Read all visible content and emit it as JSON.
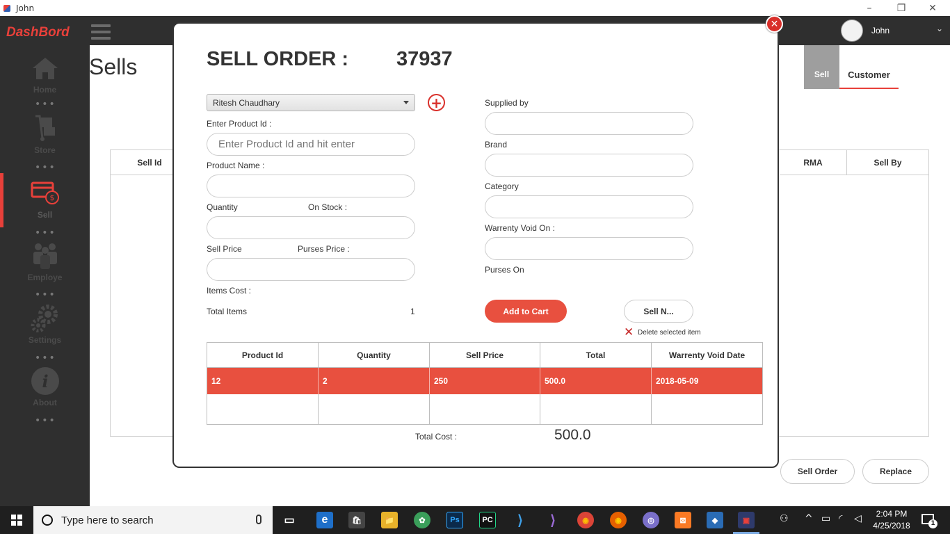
{
  "window": {
    "title": "John",
    "minimize": "–",
    "restore": "❐",
    "close": "✕"
  },
  "app": {
    "brand": "DashBord"
  },
  "sidebar": {
    "items": [
      {
        "label": "Home"
      },
      {
        "label": "Store"
      },
      {
        "label": "Sell"
      },
      {
        "label": "Employe"
      },
      {
        "label": "Settings"
      },
      {
        "label": "About"
      }
    ],
    "dots": "•••",
    "active": "Sell",
    "accent": "#e8403a"
  },
  "user": {
    "name": "John",
    "chevron": "⌄"
  },
  "page": {
    "title": "Sells",
    "tabs": [
      {
        "label": "Sell"
      },
      {
        "label": "Customer"
      }
    ],
    "table_headers": {
      "sell_id": "Sell Id",
      "rma": "RMA",
      "sell_by": "Sell By"
    },
    "buttons": {
      "sell_order": "Sell Order",
      "replace": "Replace"
    }
  },
  "modal": {
    "close_glyph": "✕",
    "title": "SELL ORDER :",
    "order_number": "37937",
    "customer_select": "Ritesh Chaudhary",
    "add_glyph": "+",
    "labels": {
      "enter_product_id": "Enter Product Id :",
      "product_name": "Product Name :",
      "quantity": "Quantity",
      "on_stock": "On Stock :",
      "sell_price": "Sell Price",
      "purses_price": "Purses Price :",
      "items_cost": "Items Cost :",
      "total_items": "Total Items",
      "supplied_by": "Supplied by",
      "brand": "Brand",
      "category": "Category",
      "warrenty_void_on": "Warrenty Void On :",
      "purses_on": "Purses On"
    },
    "product_id_placeholder": "Enter Product Id and hit enter",
    "total_items_value": "1",
    "buttons": {
      "add_to_cart": "Add to Cart",
      "sell_now": "Sell N...",
      "delete_selected": "Delete selected item",
      "delete_glyph": "✕"
    },
    "cart": {
      "headers": [
        "Product Id",
        "Quantity",
        "Sell Price",
        "Total",
        "Warrenty Void Date"
      ],
      "rows": [
        [
          "12",
          "2",
          "250",
          "500.0",
          "2018-05-09"
        ]
      ],
      "selected_color": "#e8503f"
    },
    "total_cost_label": "Total Cost :",
    "total_cost_value": "500.0"
  },
  "taskbar": {
    "search_placeholder": "Type here to search",
    "apps": [
      {
        "name": "task-view",
        "glyph": "▭"
      },
      {
        "name": "edge",
        "glyph": "e"
      },
      {
        "name": "store",
        "glyph": "🛍"
      },
      {
        "name": "file-explorer",
        "glyph": "📁"
      },
      {
        "name": "browser",
        "glyph": "✿"
      },
      {
        "name": "photoshop",
        "glyph": "Ps"
      },
      {
        "name": "pycharm",
        "glyph": "PC"
      },
      {
        "name": "vscode",
        "glyph": "⟩"
      },
      {
        "name": "visual-studio",
        "glyph": "⟩"
      },
      {
        "name": "chrome",
        "glyph": "◉"
      },
      {
        "name": "firefox",
        "glyph": "◉"
      },
      {
        "name": "app",
        "glyph": "◎"
      },
      {
        "name": "xampp",
        "glyph": "⊠"
      },
      {
        "name": "virtualbox",
        "glyph": "◆"
      },
      {
        "name": "java-app",
        "glyph": "▣"
      }
    ],
    "clock": {
      "time": "2:04 PM",
      "date": "4/25/2018"
    },
    "notification_count": "1"
  }
}
